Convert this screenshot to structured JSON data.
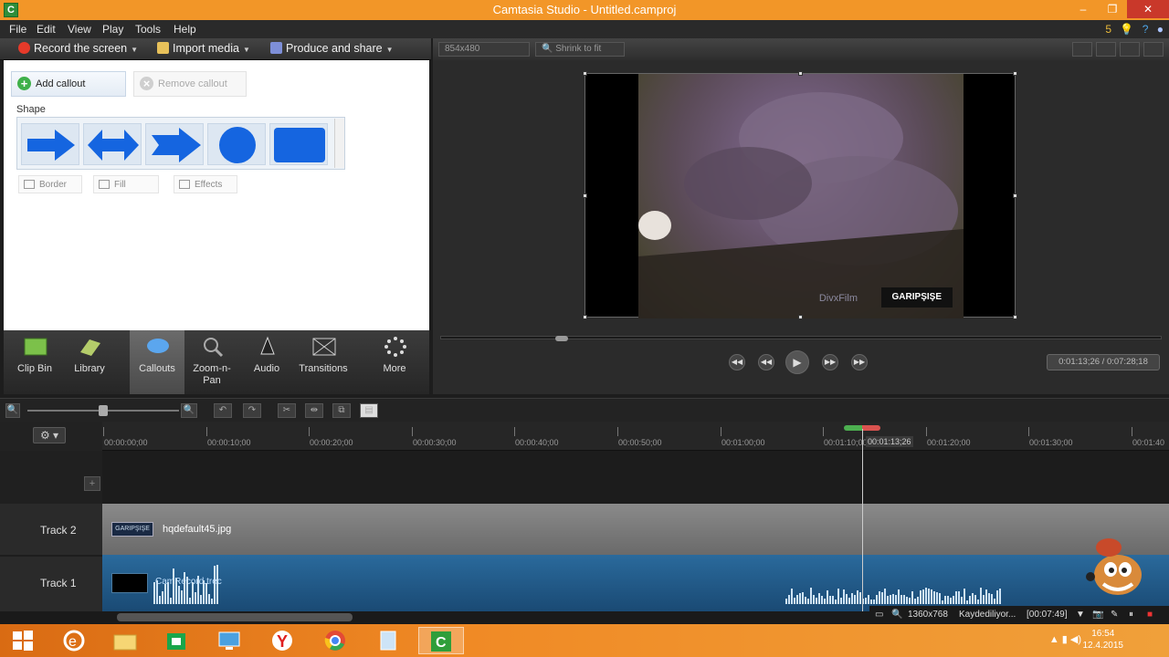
{
  "window": {
    "title": "Camtasia Studio - Untitled.camproj",
    "minimize": "‒",
    "maximize": "❐",
    "close": "✕"
  },
  "menu": {
    "items": [
      "File",
      "Edit",
      "View",
      "Play",
      "Tools",
      "Help"
    ],
    "right_badge": "5"
  },
  "toolbar": {
    "record_label": "Record the screen",
    "import_label": "Import media",
    "produce_label": "Produce and share"
  },
  "callouts": {
    "add_label": "Add callout",
    "remove_label": "Remove callout",
    "shape_label": "Shape",
    "border_label": "Border",
    "fill_label": "Fill",
    "effects_label": "Effects"
  },
  "tabs": [
    {
      "label": "Clip Bin",
      "icon": "clip-bin-icon"
    },
    {
      "label": "Library",
      "icon": "library-icon"
    },
    {
      "label": "Callouts",
      "icon": "callouts-icon"
    },
    {
      "label": "Zoom-n-Pan",
      "icon": "zoom-icon"
    },
    {
      "label": "Audio",
      "icon": "audio-icon"
    },
    {
      "label": "Transitions",
      "icon": "transitions-icon"
    },
    {
      "label": "More",
      "icon": "more-icon"
    }
  ],
  "preview": {
    "dimensions": "854x480",
    "zoom_label": "Shrink to fit",
    "watermark": "GARIPŞIŞE",
    "divx": "DivxFilm",
    "time_display": "0:01:13;26 / 0:07:28;18"
  },
  "timeline": {
    "ticks": [
      "00:00:00;00",
      "00:00:10;00",
      "00:00:20;00",
      "00:00:30;00",
      "00:00:40;00",
      "00:00:50;00",
      "00:01:00;00",
      "00:01:10;00",
      "00:01:20;00",
      "00:01:30;00",
      "00:01:40"
    ],
    "playhead_time": "00:01:13;26",
    "tracks": [
      {
        "name": "Track 2",
        "clip": "hqdefault45.jpg",
        "thumb_text": "GARIPŞIŞE"
      },
      {
        "name": "Track 1",
        "clip": "CamRecord.trec"
      }
    ]
  },
  "recorder": {
    "resolution": "1360x768",
    "status": "Kaydediliyor...",
    "elapsed": "[00:07:49]"
  },
  "taskbar": {
    "time": "16:54",
    "date": "12.4.2015"
  }
}
